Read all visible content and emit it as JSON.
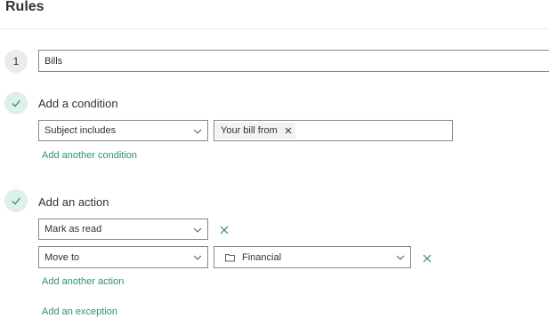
{
  "page": {
    "title": "Rules"
  },
  "rule": {
    "step_number": "1",
    "name_value": "Bills"
  },
  "condition": {
    "heading": "Add a condition",
    "field_select": "Subject includes",
    "tag_value": "Your bill from",
    "add_link": "Add another condition"
  },
  "action": {
    "heading": "Add an action",
    "action1_select": "Mark as read",
    "action2_select": "Move to",
    "folder_select": "Financial",
    "add_link": "Add another action"
  },
  "exception": {
    "add_link": "Add an exception"
  },
  "colors": {
    "accent": "#2f8f76",
    "check_bg": "#dff0ea",
    "border": "#8a8886"
  },
  "icons": {
    "check": "check-icon",
    "chevron": "chevron-down-icon",
    "close": "close-icon",
    "folder": "folder-icon"
  }
}
